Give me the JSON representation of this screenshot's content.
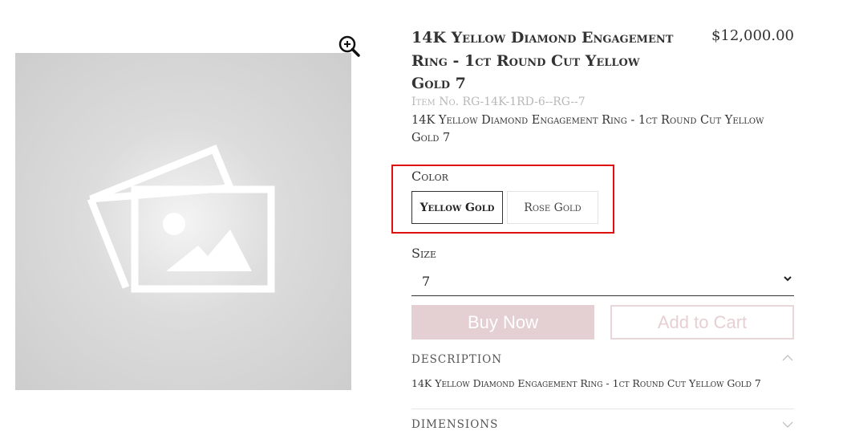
{
  "product": {
    "title": "14K Yellow Diamond Engagement Ring - 1ct Round Cut Yellow Gold 7",
    "price": "$12,000.00",
    "item_no": "Item No. RG-14K-1RD-6--RG--7",
    "subtitle": "14K Yellow Diamond Engagement Ring - 1ct Round Cut Yellow Gold 7"
  },
  "color": {
    "label": "Color",
    "options": [
      "Yellow Gold",
      "Rose Gold"
    ],
    "selected": "Yellow Gold"
  },
  "size": {
    "label": "Size",
    "value": "7"
  },
  "actions": {
    "buy_now": "Buy Now",
    "add_to_cart": "Add to Cart"
  },
  "accordion": {
    "description": {
      "label": "DESCRIPTION",
      "body": "14K Yellow Diamond Engagement Ring - 1ct Round Cut Yellow Gold 7"
    },
    "dimensions": {
      "label": "DIMENSIONS"
    }
  },
  "icons": {
    "zoom": "zoom-in-icon",
    "placeholder": "image-placeholder-icon"
  },
  "colors": {
    "highlight": "#e01010",
    "accent_pink": "#e4cfd2"
  }
}
